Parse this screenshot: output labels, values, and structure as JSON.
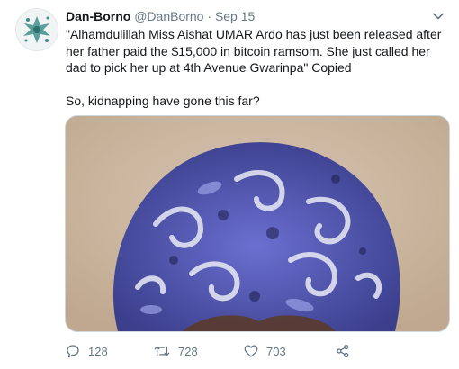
{
  "tweet": {
    "display_name": "Dan-Borno",
    "handle": "@DanBorno",
    "separator": "·",
    "date": "Sep 15",
    "text_line_1": "\"Alhamdulillah Miss Aishat UMAR Ardo has just been released after her father paid  the $15,000 in bitcoin ramsom. She just called her dad to pick her up at 4th Avenue Gwarinpa\" Copied",
    "text_line_2": "So, kidnapping have gone this far?"
  },
  "actions": {
    "reply_count": "128",
    "retweet_count": "728",
    "like_count": "703"
  },
  "icons": {
    "menu": "chevron-down-icon",
    "reply": "reply-icon",
    "retweet": "retweet-icon",
    "like": "heart-icon",
    "share": "share-icon"
  },
  "colors": {
    "text": "#14171a",
    "muted": "#657786",
    "border": "#ccd6dd"
  }
}
